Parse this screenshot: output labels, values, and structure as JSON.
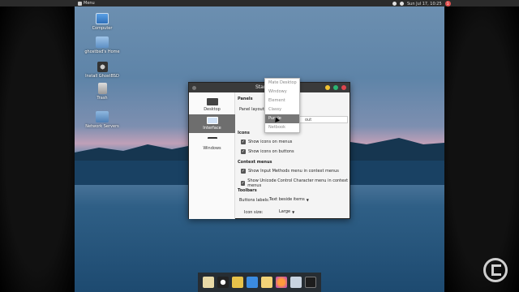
{
  "top_panel": {
    "menu_label": "Menu",
    "clock": "Sun Jul 17, 10:25",
    "notif_count": "1"
  },
  "desktop_icons": [
    {
      "label": "Computer",
      "icon": "computer-icon"
    },
    {
      "label": "ghostbsd's Home",
      "icon": "home-folder-icon"
    },
    {
      "label": "Install GhostBSD",
      "icon": "installer-icon"
    },
    {
      "label": "Trash",
      "icon": "trash-icon"
    },
    {
      "label": "Network Servers",
      "icon": "network-folder-icon"
    }
  ],
  "window": {
    "title": "Start",
    "sidebar": [
      {
        "label": "Desktop",
        "icon": "desktop-icon"
      },
      {
        "label": "Interface",
        "icon": "interface-icon",
        "active": true
      },
      {
        "label": "Windows",
        "icon": "windows-icon"
      }
    ],
    "panels": {
      "heading": "Panels",
      "layouts_label": "Panel layouts:",
      "hidden_suffix": "out"
    },
    "icons": {
      "heading": "Icons",
      "show_on_menus": "Show icons on menus",
      "show_on_buttons": "Show icons on buttons"
    },
    "context": {
      "heading": "Context menus",
      "input_methods": "Show Input Methods menu in context menus",
      "unicode": "Show Unicode Control Character menu in context menus"
    },
    "toolbars": {
      "heading": "Toolbars",
      "buttons_labels_label": "Buttons labels:",
      "buttons_labels_value": "Text beside items",
      "icon_size_label": "Icon size:",
      "icon_size_value": "Large"
    }
  },
  "layout_popup": {
    "options": [
      "Mate Desktop",
      "Windowy",
      "Element",
      "Classy",
      "Purple",
      "Netbook"
    ],
    "highlighted": "Purple"
  },
  "dock_apps": [
    "files-icon",
    "camera-icon",
    "video-icon",
    "monitor-icon",
    "notes-icon",
    "firefox-icon",
    "mail-icon",
    "terminal-icon"
  ]
}
